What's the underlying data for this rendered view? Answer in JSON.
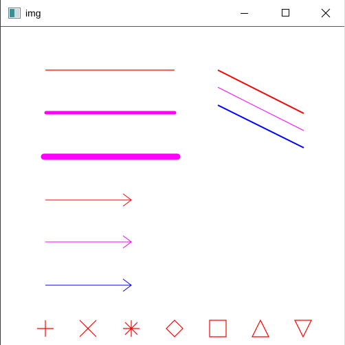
{
  "window": {
    "title": "img",
    "icons": {
      "app": "image-app-icon",
      "minimize": "minimize-icon",
      "maximize": "maximize-icon",
      "close": "close-icon"
    }
  },
  "canvas": {
    "colors": {
      "red": "#ff0000",
      "magenta": "#ff00ff",
      "blue": "#0000ff"
    },
    "lines": [
      {
        "name": "red-thin-line",
        "color": "red"
      },
      {
        "name": "magenta-medium-line",
        "color": "magenta"
      },
      {
        "name": "magenta-thick-line",
        "color": "magenta"
      },
      {
        "name": "red-arrow",
        "color": "red"
      },
      {
        "name": "magenta-arrow",
        "color": "magenta"
      },
      {
        "name": "blue-arrow",
        "color": "blue"
      },
      {
        "name": "red-diagonal-line",
        "color": "red"
      },
      {
        "name": "magenta-diagonal-line",
        "color": "magenta"
      },
      {
        "name": "blue-diagonal-line",
        "color": "blue"
      }
    ],
    "markers": [
      "cross",
      "tilted-cross",
      "star",
      "diamond",
      "square",
      "triangle-up",
      "triangle-down"
    ],
    "marker_color": "red"
  }
}
